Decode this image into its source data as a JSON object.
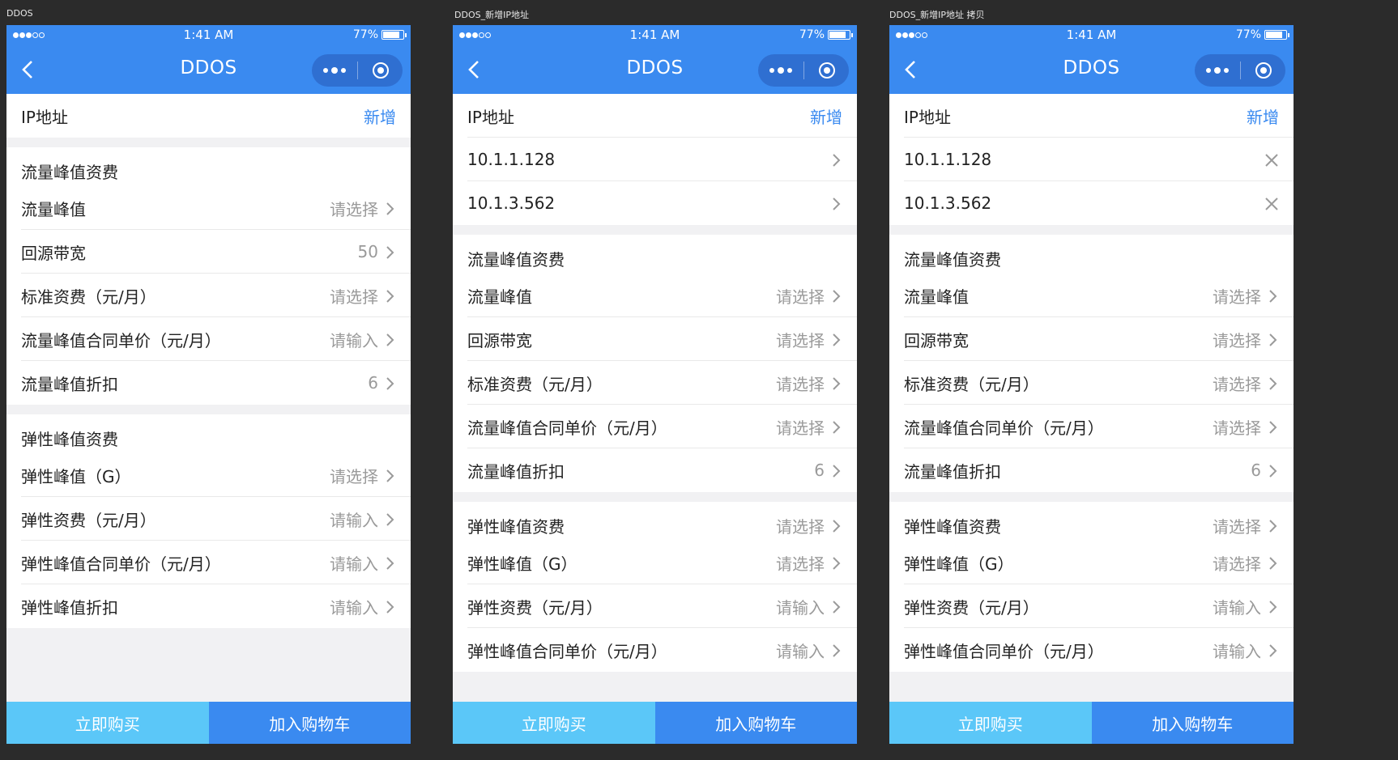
{
  "artboards": [
    {
      "label": "DDOS",
      "status": {
        "time": "1:41 AM",
        "battery": "77%"
      },
      "title": "DDOS",
      "ip": {
        "label": "IP地址",
        "add": "新增",
        "items": []
      },
      "traffic": {
        "title": "流量峰值资费",
        "rows": [
          {
            "label": "流量峰值",
            "value": "请选择"
          },
          {
            "label": "回源带宽",
            "value": "50"
          },
          {
            "label": "标准资费（元/月）",
            "value": "请选择"
          },
          {
            "label": "流量峰值合同单价（元/月）",
            "value": "请输入"
          },
          {
            "label": "流量峰值折扣",
            "value": "6"
          }
        ]
      },
      "elastic": {
        "title": "弹性峰值资费",
        "title_value": "",
        "rows": [
          {
            "label": "弹性峰值（G）",
            "value": "请选择"
          },
          {
            "label": "弹性资费（元/月）",
            "value": "请输入"
          },
          {
            "label": "弹性峰值合同单价（元/月）",
            "value": "请输入"
          },
          {
            "label": "弹性峰值折扣",
            "value": "请输入"
          }
        ]
      },
      "buttons": {
        "buy": "立即购买",
        "cart": "加入购物车"
      }
    },
    {
      "label": "DDOS_新增IP地址",
      "status": {
        "time": "1:41 AM",
        "battery": "77%"
      },
      "title": "DDOS",
      "ip": {
        "label": "IP地址",
        "add": "新增",
        "items": [
          "10.1.1.128",
          "10.1.3.562"
        ],
        "item_icon": "chevron-right-icon"
      },
      "traffic": {
        "title": "流量峰值资费",
        "rows": [
          {
            "label": "流量峰值",
            "value": "请选择"
          },
          {
            "label": "回源带宽",
            "value": "请选择"
          },
          {
            "label": "标准资费（元/月）",
            "value": "请选择"
          },
          {
            "label": "流量峰值合同单价（元/月）",
            "value": "请选择"
          },
          {
            "label": "流量峰值折扣",
            "value": "6"
          }
        ]
      },
      "elastic": {
        "title": "弹性峰值资费",
        "title_value": "请选择",
        "rows": [
          {
            "label": "弹性峰值（G）",
            "value": "请选择"
          },
          {
            "label": "弹性资费（元/月）",
            "value": "请输入"
          },
          {
            "label": "弹性峰值合同单价（元/月）",
            "value": "请输入"
          }
        ]
      },
      "buttons": {
        "buy": "立即购买",
        "cart": "加入购物车"
      }
    },
    {
      "label": "DDOS_新增IP地址 拷贝",
      "status": {
        "time": "1:41 AM",
        "battery": "77%"
      },
      "title": "DDOS",
      "ip": {
        "label": "IP地址",
        "add": "新增",
        "items": [
          "10.1.1.128",
          "10.1.3.562"
        ],
        "item_icon": "close-icon"
      },
      "traffic": {
        "title": "流量峰值资费",
        "rows": [
          {
            "label": "流量峰值",
            "value": "请选择"
          },
          {
            "label": "回源带宽",
            "value": "请选择"
          },
          {
            "label": "标准资费（元/月）",
            "value": "请选择"
          },
          {
            "label": "流量峰值合同单价（元/月）",
            "value": "请选择"
          },
          {
            "label": "流量峰值折扣",
            "value": "6"
          }
        ]
      },
      "elastic": {
        "title": "弹性峰值资费",
        "title_value": "请选择",
        "rows": [
          {
            "label": "弹性峰值（G）",
            "value": "请选择"
          },
          {
            "label": "弹性资费（元/月）",
            "value": "请输入"
          },
          {
            "label": "弹性峰值合同单价（元/月）",
            "value": "请输入"
          }
        ]
      },
      "buttons": {
        "buy": "立即购买",
        "cart": "加入购物车"
      }
    }
  ],
  "colors": {
    "primary": "#3a8af0",
    "buy": "#5bc7f8",
    "canvas": "#2b2b2b",
    "muted": "#9a9a9a"
  }
}
